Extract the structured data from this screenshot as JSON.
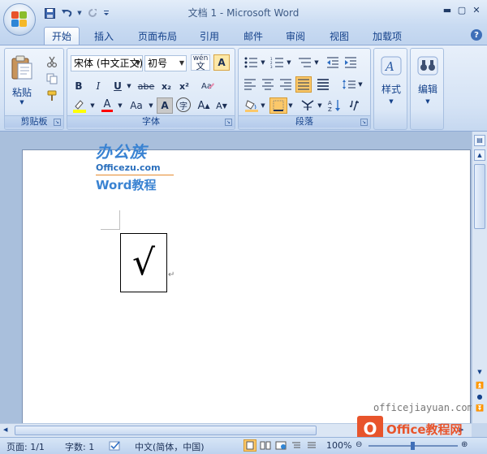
{
  "window": {
    "title": "文档 1 - Microsoft Word"
  },
  "quick_access": {
    "save": "save-icon",
    "undo": "undo-icon",
    "redo": "redo-icon",
    "customize": "customize-icon"
  },
  "tabs": [
    {
      "label": "开始",
      "active": true
    },
    {
      "label": "插入"
    },
    {
      "label": "页面布局"
    },
    {
      "label": "引用"
    },
    {
      "label": "邮件"
    },
    {
      "label": "审阅"
    },
    {
      "label": "视图"
    },
    {
      "label": "加载项"
    }
  ],
  "ribbon": {
    "clipboard": {
      "label": "剪贴板",
      "paste": "粘贴"
    },
    "font": {
      "label": "字体",
      "font_name": "宋体 (中文正文)",
      "font_size": "初号",
      "bold": "B",
      "italic": "I",
      "underline": "U",
      "strike": "abe",
      "subscript": "x₂",
      "superscript": "x²",
      "wen": "wén",
      "char_border": "A",
      "grow": "A",
      "shrink": "A",
      "case": "Aa",
      "char_shading": "A",
      "enclose": "字"
    },
    "paragraph": {
      "label": "段落"
    },
    "styles": {
      "label": "样式"
    },
    "editing": {
      "label": "编辑"
    }
  },
  "document": {
    "watermark_brand": "办公族",
    "watermark_site": "Officezu.com",
    "watermark_sub": "Word教程",
    "content_char": "√",
    "bottom_site": "officejiayuan.com",
    "bottom_logo_text": "Office教程网"
  },
  "status_bar": {
    "page": "页面: 1/1",
    "words": "字数: 1",
    "language": "中文(简体，中国)",
    "zoom": "100%"
  },
  "colors": {
    "accent": "#15428b",
    "highlight": "#ffff00",
    "font_color": "#ff0000"
  }
}
